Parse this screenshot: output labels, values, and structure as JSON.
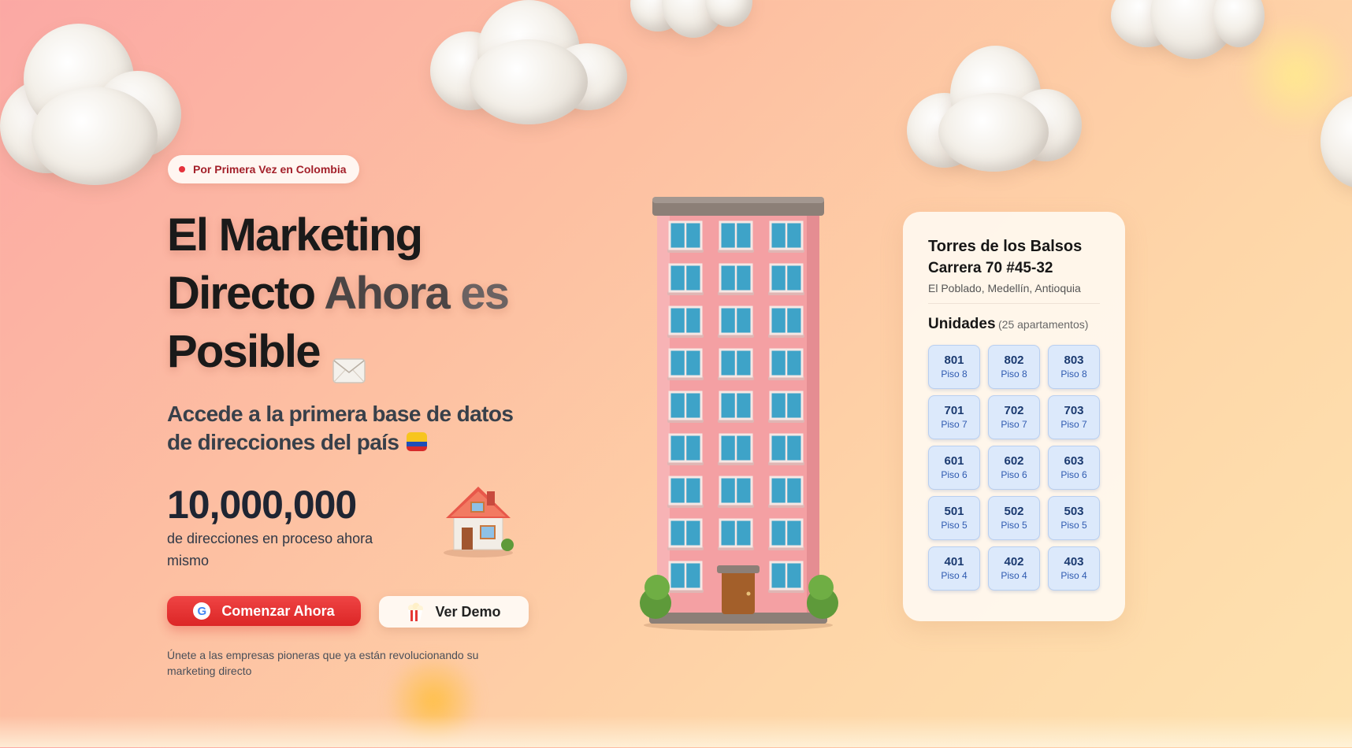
{
  "hero": {
    "badge": "Por Primera Vez en Colombia",
    "headline": {
      "line1": "El Marketing",
      "line2_a": "Directo",
      "line2_b": "Ahora",
      "line2_c": "es",
      "line3": "Posible"
    },
    "subheadline_line1": "Accede a la primera base de datos",
    "subheadline_line2": "de direcciones del país",
    "stat_value": "10,000,000",
    "stat_label": "de direcciones en proceso ahora mismo",
    "primary_button": "Comenzar Ahora",
    "secondary_button": "Ver Demo",
    "footnote": "Únete a las empresas pioneras que ya están revolucionando su marketing directo"
  },
  "icons": {
    "envelope": "envelope-icon",
    "flag": "colombia-flag-icon",
    "house": "house-icon",
    "google": "google-icon",
    "popcorn": "popcorn-icon",
    "building": "building-illustration"
  },
  "colors": {
    "accent": "#e5323c",
    "unit_bg": "#dce9fb",
    "unit_text": "#1b3a70"
  },
  "card": {
    "building_name": "Torres de los Balsos",
    "address": "Carrera 70 #45-32",
    "location": "El Poblado, Medellín, Antioquia",
    "units_title": "Unidades",
    "units_count": "(25 apartamentos)",
    "units": [
      {
        "number": "801",
        "floor": "Piso 8"
      },
      {
        "number": "802",
        "floor": "Piso 8"
      },
      {
        "number": "803",
        "floor": "Piso 8"
      },
      {
        "number": "701",
        "floor": "Piso 7"
      },
      {
        "number": "702",
        "floor": "Piso 7"
      },
      {
        "number": "703",
        "floor": "Piso 7"
      },
      {
        "number": "601",
        "floor": "Piso 6"
      },
      {
        "number": "602",
        "floor": "Piso 6"
      },
      {
        "number": "603",
        "floor": "Piso 6"
      },
      {
        "number": "501",
        "floor": "Piso 5"
      },
      {
        "number": "502",
        "floor": "Piso 5"
      },
      {
        "number": "503",
        "floor": "Piso 5"
      },
      {
        "number": "401",
        "floor": "Piso 4"
      },
      {
        "number": "402",
        "floor": "Piso 4"
      },
      {
        "number": "403",
        "floor": "Piso 4"
      }
    ]
  }
}
